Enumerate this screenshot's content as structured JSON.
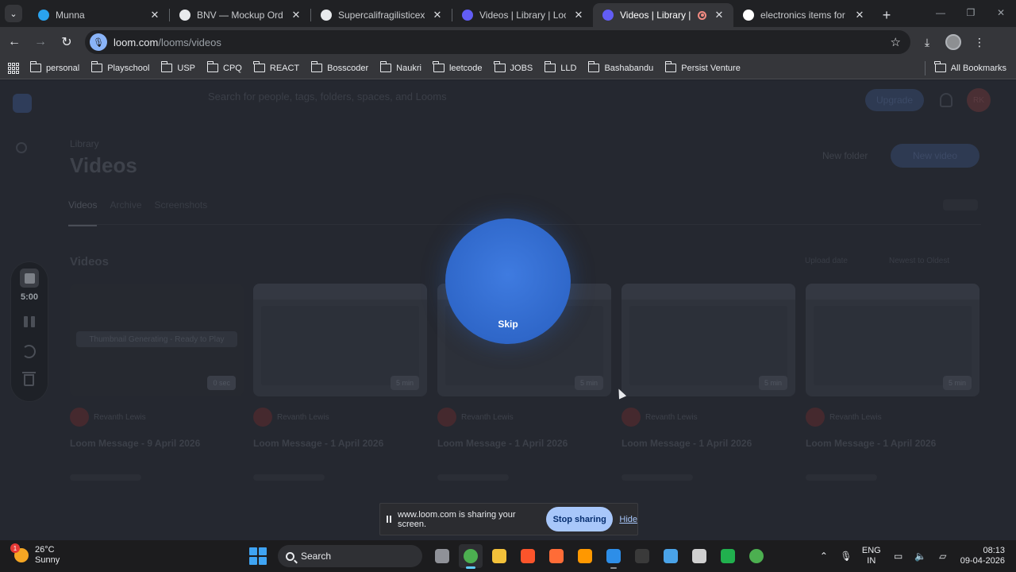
{
  "browser": {
    "tabs": [
      {
        "title": "Munna",
        "favicon_color": "#2aa3ef",
        "active": false
      },
      {
        "title": "BNV — Mockup Ordering S",
        "favicon_color": "#e8eaed",
        "active": false
      },
      {
        "title": "Supercalifragilisticexpialido",
        "favicon_color": "#e8eaed",
        "active": false
      },
      {
        "title": "Videos | Library | Loom",
        "favicon_color": "#625df5",
        "active": false
      },
      {
        "title": "Videos | Library | Loom",
        "favicon_color": "#625df5",
        "active": true,
        "recording": true
      },
      {
        "title": "electronics items for shopp",
        "favicon_color": "#ffffff",
        "active": false
      }
    ],
    "url_host": "loom.com",
    "url_path": "/looms/videos",
    "bookmarks": [
      "personal",
      "Playschool",
      "USP",
      "CPQ",
      "REACT",
      "Bosscoder",
      "Naukri",
      "leetcode",
      "JOBS",
      "LLD",
      "Bashabandu",
      "Persist Venture"
    ],
    "all_bookmarks": "All Bookmarks"
  },
  "loom": {
    "search_placeholder": "Search for people, tags, folders, spaces, and Looms",
    "upgrade_label": "Upgrade",
    "avatar_initials": "RK",
    "breadcrumb": "Library",
    "page_title": "Videos",
    "new_folder_label": "New folder",
    "new_video_label": "New video",
    "tabs": [
      "Videos",
      "Archive",
      "Screenshots"
    ],
    "section_title": "Videos",
    "sort_labels": [
      "Upload date",
      "Newest to Oldest"
    ],
    "cards": [
      {
        "author": "Revanth Lewis",
        "title": "Loom Message - 9 April 2026",
        "duration": "0 sec",
        "status": "Thumbnail Generating - Ready to Play",
        "plain": true
      },
      {
        "author": "Revanth Lewis",
        "title": "Loom Message - 1 April 2026",
        "duration": "5 min",
        "plain": false
      },
      {
        "author": "Revanth Lewis",
        "title": "Loom Message - 1 April 2026",
        "duration": "5 min",
        "plain": false
      },
      {
        "author": "Revanth Lewis",
        "title": "Loom Message - 1 April 2026",
        "duration": "5 min",
        "plain": false
      },
      {
        "author": "Revanth Lewis",
        "title": "Loom Message - 1 April 2026",
        "duration": "5 min",
        "plain": false
      }
    ]
  },
  "recorder": {
    "timer": "5:00",
    "skip_label": "Skip"
  },
  "share_bar": {
    "message": "www.loom.com is sharing your screen.",
    "stop_label": "Stop sharing",
    "hide_label": "Hide"
  },
  "taskbar": {
    "temperature": "26°C",
    "weather": "Sunny",
    "weather_badge": "1",
    "search_label": "Search",
    "apps": [
      {
        "name": "task-view",
        "color": "#8f9198"
      },
      {
        "name": "chrome",
        "color": "#4caf50",
        "active": true
      },
      {
        "name": "file-explorer",
        "color": "#f3c13a"
      },
      {
        "name": "brave",
        "color": "#fb542b"
      },
      {
        "name": "postman",
        "color": "#ff6c37"
      },
      {
        "name": "sublime",
        "color": "#ff9800"
      },
      {
        "name": "vscode",
        "color": "#2d8ee8",
        "running": true
      },
      {
        "name": "terminal",
        "color": "#3a3a3a"
      },
      {
        "name": "notepad",
        "color": "#4aa3e8"
      },
      {
        "name": "github-desktop",
        "color": "#d0d0d0"
      },
      {
        "name": "mongodb-compass",
        "color": "#21b04e"
      },
      {
        "name": "chrome-profile",
        "color": "#4caf50"
      }
    ],
    "language": "ENG",
    "region": "IN",
    "time": "08:13",
    "date": "09-04-2026"
  }
}
